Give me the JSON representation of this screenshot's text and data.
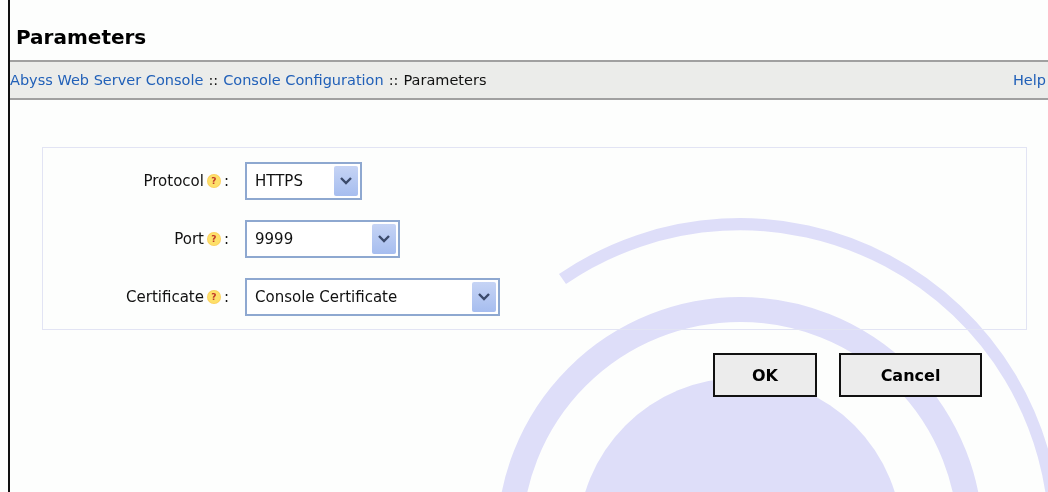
{
  "page_title": "Parameters",
  "breadcrumb": [
    {
      "label": "Abyss Web Server Console",
      "link": true
    },
    {
      "label": "Console Configuration",
      "link": true
    },
    {
      "label": "Parameters",
      "link": false
    }
  ],
  "breadcrumb_separator": "::",
  "help_link": "Help",
  "fields": [
    {
      "label": "Protocol",
      "value": "HTTPS"
    },
    {
      "label": "Port",
      "value": "9999"
    },
    {
      "label": "Certificate",
      "value": "Console Certificate"
    }
  ],
  "help_mark": "?",
  "field_suffix": ":",
  "buttons": [
    "OK",
    "Cancel"
  ]
}
